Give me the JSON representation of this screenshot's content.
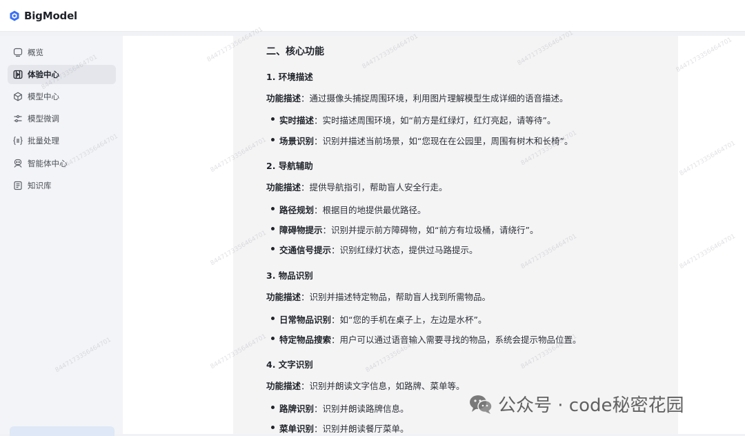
{
  "app": {
    "name": "BigModel"
  },
  "sidebar": {
    "items": [
      {
        "label": "概览",
        "icon": "chat-square-icon",
        "active": false
      },
      {
        "label": "体验中心",
        "icon": "play-frame-icon",
        "active": true
      },
      {
        "label": "模型中心",
        "icon": "cube-icon",
        "active": false
      },
      {
        "label": "模型微调",
        "icon": "tune-icon",
        "active": false
      },
      {
        "label": "批量处理",
        "icon": "braces-list-icon",
        "active": false
      },
      {
        "label": "智能体中心",
        "icon": "agent-icon",
        "active": false
      },
      {
        "label": "知识库",
        "icon": "book-icon",
        "active": false
      }
    ]
  },
  "doc": {
    "section_title": "二、核心功能",
    "blocks": [
      {
        "heading": "1. 环境描述",
        "desc_label": "功能描述",
        "desc_text": "：通过摄像头捕捉周围环境，利用图片理解模型生成详细的语音描述。",
        "bullets": [
          {
            "label": "实时描述",
            "text": "：实时描述周围环境，如“前方是红绿灯，红灯亮起，请等待”。"
          },
          {
            "label": "场景识别",
            "text": "：识别并描述当前场景，如“您现在在公园里，周围有树木和长椅”。"
          }
        ]
      },
      {
        "heading": "2. 导航辅助",
        "desc_label": "功能描述",
        "desc_text": "：提供导航指引，帮助盲人安全行走。",
        "bullets": [
          {
            "label": "路径规划",
            "text": "：根据目的地提供最优路径。"
          },
          {
            "label": "障碍物提示",
            "text": "：识别并提示前方障碍物，如“前方有垃圾桶，请绕行”。"
          },
          {
            "label": "交通信号提示",
            "text": "：识别红绿灯状态，提供过马路提示。"
          }
        ]
      },
      {
        "heading": "3. 物品识别",
        "desc_label": "功能描述",
        "desc_text": "：识别并描述特定物品，帮助盲人找到所需物品。",
        "bullets": [
          {
            "label": "日常物品识别",
            "text": "：如“您的手机在桌子上，左边是水杯”。"
          },
          {
            "label": "特定物品搜索",
            "text": "：用户可以通过语音输入需要寻找的物品，系统会提示物品位置。"
          }
        ]
      },
      {
        "heading": "4. 文字识别",
        "desc_label": "功能描述",
        "desc_text": "：识别并朗读文字信息，如路牌、菜单等。",
        "bullets": [
          {
            "label": "路牌识别",
            "text": "：识别并朗读路牌信息。"
          },
          {
            "label": "菜单识别",
            "text": "：识别并朗读餐厅菜单。"
          }
        ]
      }
    ]
  },
  "watermark": {
    "text": "8447173356464701"
  },
  "overlay": {
    "text": "公众号 · code秘密花园",
    "icon": "wechat-icon"
  },
  "colors": {
    "brand": "#3b6ff5",
    "active_bg": "#e4e6ec",
    "doc_bg": "#f4f4f5"
  }
}
